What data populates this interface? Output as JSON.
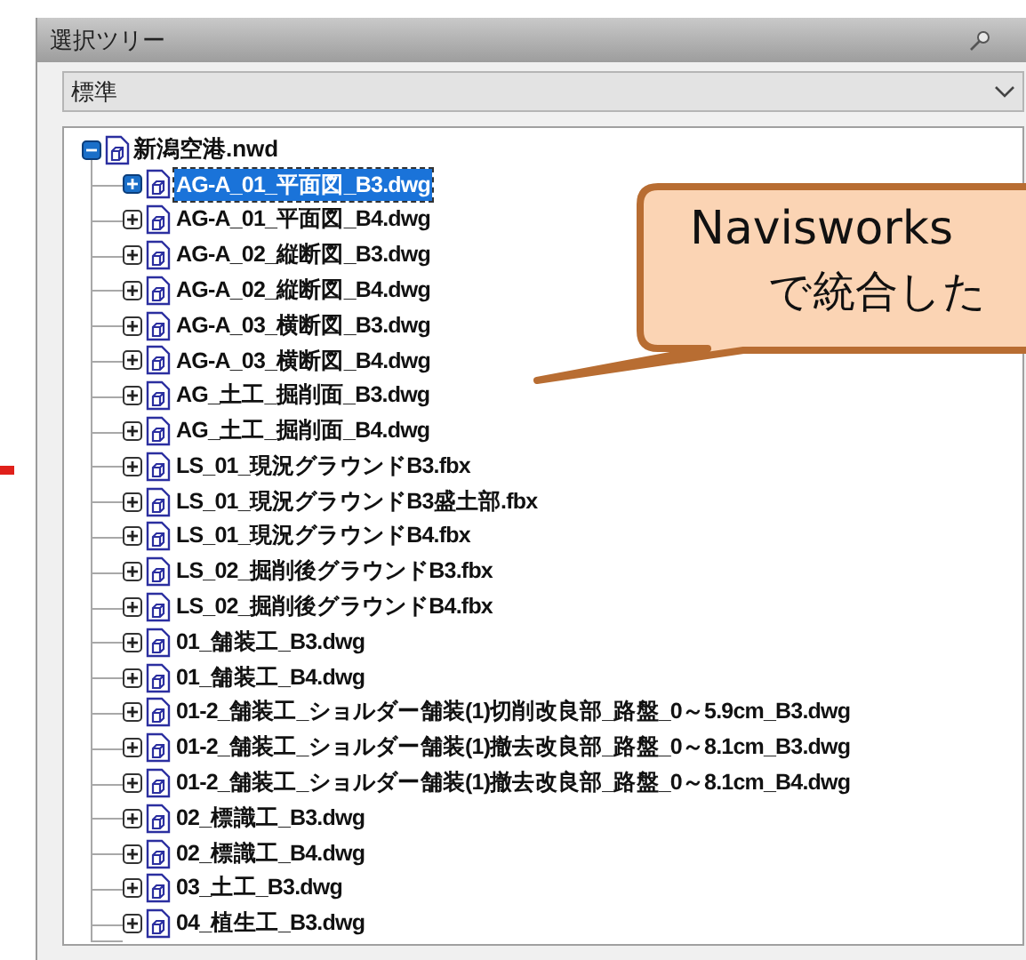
{
  "panel": {
    "title": "選択ツリー",
    "dropdown": {
      "value": "標準"
    }
  },
  "tree": {
    "label": "新潟空港.nwd",
    "expanded": true,
    "children": [
      {
        "label": "AG-A_01_平面図_B3.dwg",
        "selected": true,
        "expanded": false
      },
      {
        "label": "AG-A_01_平面図_B4.dwg",
        "selected": false,
        "expanded": false
      },
      {
        "label": "AG-A_02_縦断図_B3.dwg",
        "selected": false,
        "expanded": false
      },
      {
        "label": "AG-A_02_縦断図_B4.dwg",
        "selected": false,
        "expanded": false
      },
      {
        "label": "AG-A_03_横断図_B3.dwg",
        "selected": false,
        "expanded": false
      },
      {
        "label": "AG-A_03_横断図_B4.dwg",
        "selected": false,
        "expanded": false
      },
      {
        "label": "AG_土工_掘削面_B3.dwg",
        "selected": false,
        "expanded": false
      },
      {
        "label": "AG_土工_掘削面_B4.dwg",
        "selected": false,
        "expanded": false
      },
      {
        "label": "LS_01_現況グラウンドB3.fbx",
        "selected": false,
        "expanded": false
      },
      {
        "label": "LS_01_現況グラウンドB3盛土部.fbx",
        "selected": false,
        "expanded": false
      },
      {
        "label": "LS_01_現況グラウンドB4.fbx",
        "selected": false,
        "expanded": false
      },
      {
        "label": "LS_02_掘削後グラウンドB3.fbx",
        "selected": false,
        "expanded": false
      },
      {
        "label": "LS_02_掘削後グラウンドB4.fbx",
        "selected": false,
        "expanded": false
      },
      {
        "label": "01_舗装工_B3.dwg",
        "selected": false,
        "expanded": false
      },
      {
        "label": "01_舗装工_B4.dwg",
        "selected": false,
        "expanded": false
      },
      {
        "label": "01-2_舗装工_ショルダー舗装(1)切削改良部_路盤_0～5.9cm_B3.dwg",
        "selected": false,
        "expanded": false
      },
      {
        "label": "01-2_舗装工_ショルダー舗装(1)撤去改良部_路盤_0～8.1cm_B3.dwg",
        "selected": false,
        "expanded": false
      },
      {
        "label": "01-2_舗装工_ショルダー舗装(1)撤去改良部_路盤_0～8.1cm_B4.dwg",
        "selected": false,
        "expanded": false
      },
      {
        "label": "02_標識工_B3.dwg",
        "selected": false,
        "expanded": false
      },
      {
        "label": "02_標識工_B4.dwg",
        "selected": false,
        "expanded": false
      },
      {
        "label": "03_土工_B3.dwg",
        "selected": false,
        "expanded": false
      },
      {
        "label": "04_植生工_B3.dwg",
        "selected": false,
        "expanded": false
      }
    ]
  },
  "callout": {
    "lines": [
      "Navisworks",
      "で統合した"
    ]
  }
}
